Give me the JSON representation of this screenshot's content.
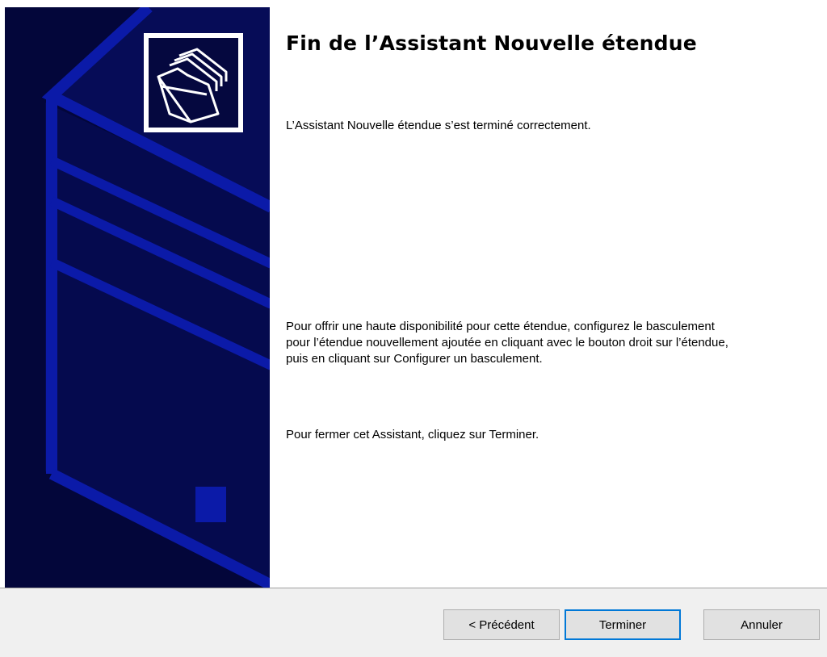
{
  "wizard": {
    "title": "Fin de l’Assistant Nouvelle étendue",
    "success_message": "L’Assistant Nouvelle étendue s’est terminé correctement.",
    "failover_message": "Pour offrir une haute disponibilité pour cette étendue, configurez le basculement pour l’étendue nouvellement ajoutée en cliquant avec le bouton droit sur l’étendue, puis en cliquant sur Configurer un basculement.",
    "close_message": "Pour fermer cet Assistant, cliquez sur Terminer."
  },
  "buttons": {
    "back_label": "< Précédent",
    "finish_label": "Terminer",
    "cancel_label": "Annuler"
  },
  "icons": {
    "banner_icon": "folders-icon",
    "banner_graphic": "server-tower-graphic"
  },
  "colors": {
    "banner_background": "#03063a",
    "banner_accent": "#0b1aa8",
    "footer_background": "#f0f0f0",
    "default_button_border": "#0078d7"
  }
}
